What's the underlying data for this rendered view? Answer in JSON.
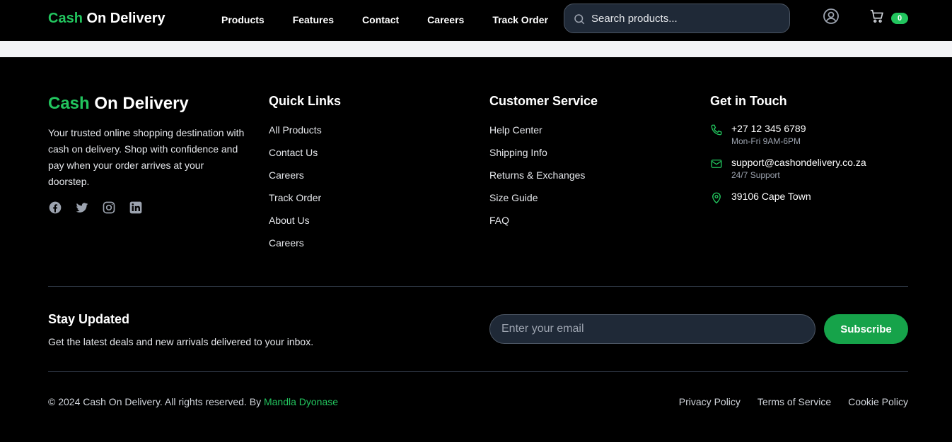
{
  "brand": {
    "part1": "Cash",
    "part2": "On Delivery"
  },
  "nav": [
    "Products",
    "Features",
    "Contact",
    "Careers",
    "Track Order"
  ],
  "search": {
    "placeholder": "Search products..."
  },
  "cart": {
    "count": "0"
  },
  "footer": {
    "about": "Your trusted online shopping destination with cash on delivery. Shop with confidence and pay when your order arrives at your doorstep.",
    "socials": [
      "facebook-icon",
      "twitter-icon",
      "instagram-icon",
      "linkedin-icon"
    ],
    "quick_links": {
      "title": "Quick Links",
      "items": [
        "All Products",
        "Contact Us",
        "Careers",
        "Track Order",
        "About Us",
        "Careers"
      ]
    },
    "customer_service": {
      "title": "Customer Service",
      "items": [
        "Help Center",
        "Shipping Info",
        "Returns & Exchanges",
        "Size Guide",
        "FAQ"
      ]
    },
    "contact": {
      "title": "Get in Touch",
      "phone": "+27 12 345 6789",
      "phone_hours": "Mon-Fri 9AM-6PM",
      "email": "support@cashondelivery.co.za",
      "email_note": "24/7 Support",
      "address": "39106 Cape Town"
    },
    "newsletter": {
      "title": "Stay Updated",
      "subtitle": "Get the latest deals and new arrivals delivered to your inbox.",
      "placeholder": "Enter your email",
      "button": "Subscribe"
    },
    "copyright": "© 2024 Cash On Delivery. All rights reserved. By",
    "author": "Mandla Dyonase",
    "legal": [
      "Privacy Policy",
      "Terms of Service",
      "Cookie Policy"
    ]
  },
  "colors": {
    "accent": "#22c55e",
    "button": "#16a34a",
    "background": "#000000"
  }
}
